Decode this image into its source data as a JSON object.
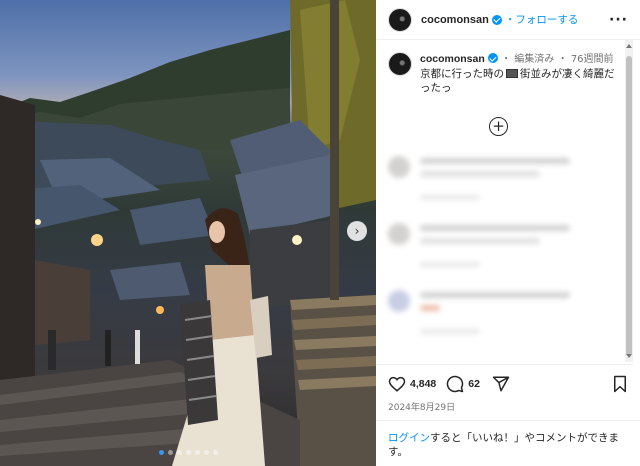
{
  "post": {
    "username": "cocomonsan",
    "follow_label": "・フォローする",
    "more_icon": "more-horizontal-icon"
  },
  "caption": {
    "username": "cocomonsan",
    "edited": "・ 編集済み",
    "time_ago": "・ 76週間前",
    "text_before": "京都に行った時の",
    "text_after": "街並みが凄く綺麗だったっ"
  },
  "actions": {
    "likes": "4,848",
    "comments": "62"
  },
  "date": "2024年8月29日",
  "login": {
    "link": "ログイン",
    "rest": "すると「いいね！」やコメントができます。"
  },
  "colors": {
    "accent": "#0095f6",
    "text": "#262626",
    "muted": "#737373"
  }
}
